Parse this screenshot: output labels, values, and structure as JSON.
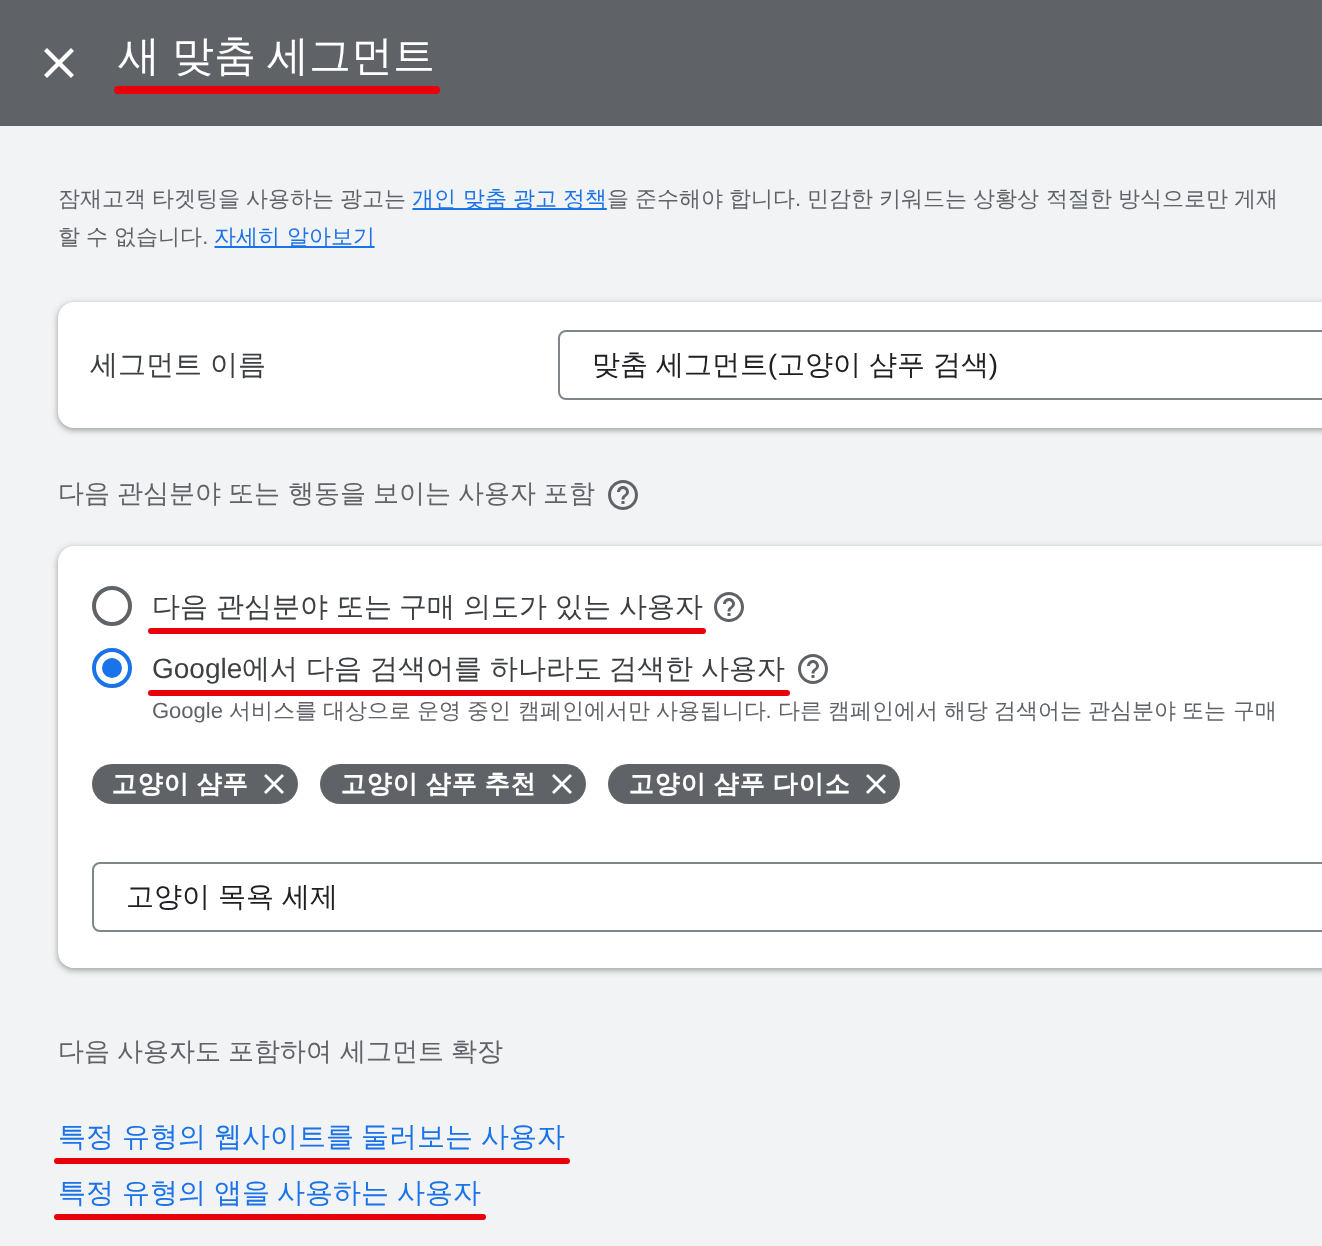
{
  "header": {
    "title": "새 맞춤 세그먼트",
    "annotated": true
  },
  "notice": {
    "segments": [
      {
        "kind": "text",
        "text": "잠재고객 타겟팅을 사용하는 광고는 "
      },
      {
        "kind": "link",
        "text": "개인 맞춤 광고 정책"
      },
      {
        "kind": "text",
        "text": "을 준수해야 합니다. 민감한 키워드는 상황상 적절한 방식으로만 게재"
      },
      {
        "kind": "break"
      },
      {
        "kind": "text",
        "text": "할 수 없습니다. "
      },
      {
        "kind": "link",
        "text": "자세히 알아보기"
      }
    ]
  },
  "name_card": {
    "label": "세그먼트 이름",
    "value": "맞춤 세그먼트(고양이 샴푸 검색)"
  },
  "include_section": {
    "heading": "다음 관심분야 또는 행동을 보이는 사용자 포함",
    "options": [
      {
        "label": "다음 관심분야 또는 구매 의도가 있는 사용자",
        "selected": false,
        "annotated": true
      },
      {
        "label": "Google에서 다음 검색어를 하나라도 검색한 사용자",
        "selected": true,
        "annotated": true,
        "hint": "Google 서비스를 대상으로 운영 중인 캠페인에서만 사용됩니다. 다른 캠페인에서 해당 검색어는 관심분야 또는 구매"
      }
    ],
    "keywords": [
      "고양이 샴푸",
      "고양이 샴푸 추천",
      "고양이 샴푸 다이소"
    ],
    "keyword_input": {
      "value": "고양이 목욕 세제"
    }
  },
  "expand_section": {
    "heading": "다음 사용자도 포함하여 세그먼트 확장",
    "links": [
      {
        "label": "특정 유형의 웹사이트를 둘러보는 사용자",
        "annotated": true
      },
      {
        "label": "특정 유형의 앱을 사용하는 사용자",
        "annotated": true
      }
    ]
  }
}
